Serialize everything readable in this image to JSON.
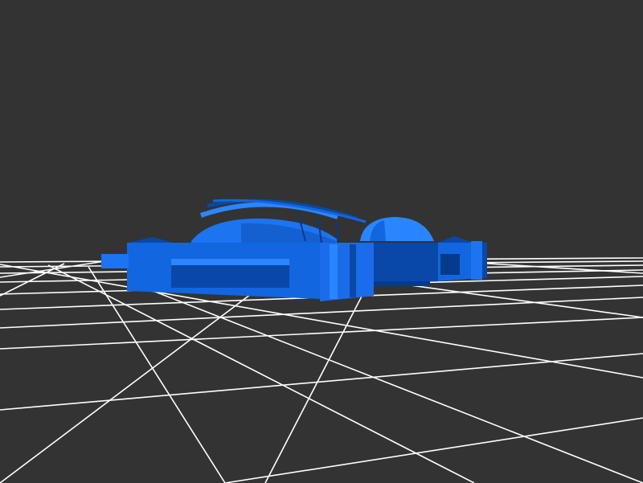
{
  "scene": {
    "background_color": "#333333",
    "grid_color": "#ffffff",
    "model_color": "#1266e0",
    "model_highlight_color": "#2a86ff",
    "model_shadow_color": "#0a48a8",
    "model_dark_color": "#063a8c"
  }
}
